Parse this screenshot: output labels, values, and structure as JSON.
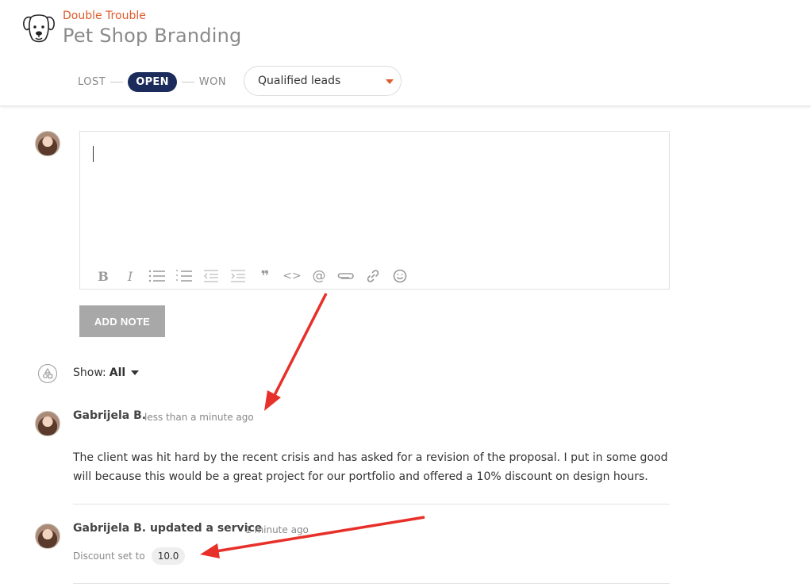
{
  "header": {
    "company": "Double Trouble",
    "title": "Pet Shop Branding"
  },
  "pipeline": {
    "stages": [
      "LOST",
      "OPEN",
      "WON"
    ],
    "active_stage": "OPEN"
  },
  "lead_dropdown": {
    "selected": "Qualified leads"
  },
  "editor": {
    "toolbar": [
      "bold-icon",
      "italic-icon",
      "bullet-list-icon",
      "numbered-list-icon",
      "outdent-icon",
      "indent-icon",
      "quote-icon",
      "code-icon",
      "mention-icon",
      "attachment-icon",
      "link-icon",
      "emoji-icon"
    ],
    "toolbar_glyphs": {
      "bold": "B",
      "italic": "I",
      "quote": "❞",
      "code": "<>",
      "mention": "@"
    },
    "add_note_label": "ADD NOTE"
  },
  "filter": {
    "show_label": "Show:",
    "show_value": "All"
  },
  "activity": [
    {
      "author": "Gabrijela B.",
      "time": "less than a minute ago",
      "body": "The client was hit hard by the recent crisis and has asked for a revision of the proposal. I put in some good will because this would be a great project for our portfolio and offered a 10% discount on design hours."
    },
    {
      "author": "Gabrijela B.",
      "action": "updated a service",
      "time": "1 minute ago",
      "detail_label": "Discount set to",
      "detail_value": "10.0"
    }
  ],
  "colors": {
    "accent": "#e05a2b",
    "stage_active": "#1b2b5b",
    "annotation_arrow": "#e8302a"
  }
}
